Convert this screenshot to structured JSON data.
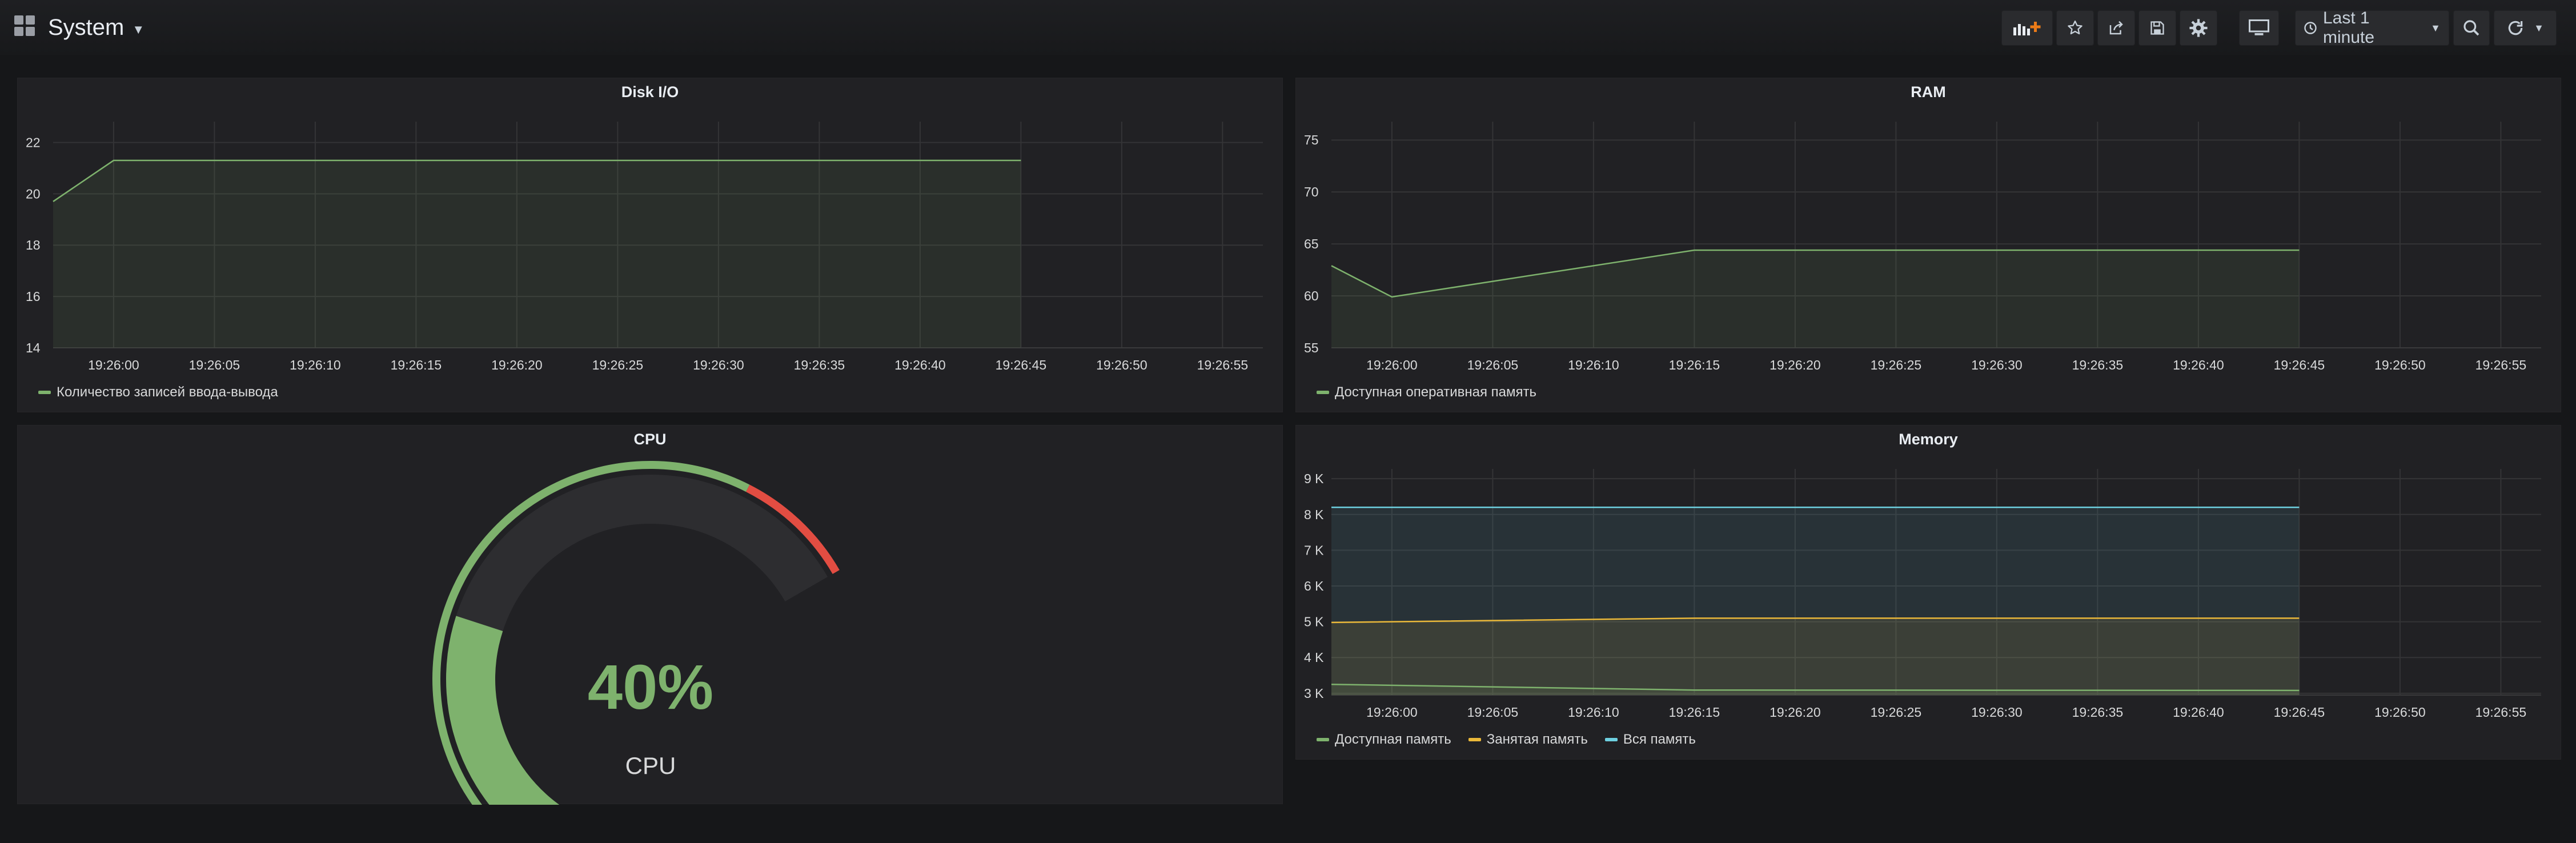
{
  "dashboard": {
    "title": "System",
    "time_range": "Last 1 minute"
  },
  "toolbar": {
    "add_panel_icon": "add-panel-icon",
    "star_icon": "star-icon",
    "share_icon": "share-icon",
    "save_icon": "save-icon",
    "settings_icon": "gear-icon",
    "tv_mode_icon": "monitor-icon",
    "clock_icon": "clock-icon",
    "zoom_icon": "zoom-out-icon",
    "refresh_icon": "refresh-icon",
    "refresh_caret_icon": "chevron-down-icon"
  },
  "colors": {
    "green": "#7eb26d",
    "yellow": "#eab839",
    "blue": "#6ed0e0",
    "red": "#e24d42"
  },
  "chart_data": [
    {
      "id": "disk",
      "type": "line",
      "title": "Disk I/O",
      "x": [
        "19:25:57",
        "19:26:00",
        "19:26:45"
      ],
      "x_ticks": [
        "19:26:00",
        "19:26:05",
        "19:26:10",
        "19:26:15",
        "19:26:20",
        "19:26:25",
        "19:26:30",
        "19:26:35",
        "19:26:40",
        "19:26:45",
        "19:26:50",
        "19:26:55"
      ],
      "y_ticks": [
        "14",
        "16",
        "18",
        "20",
        "22"
      ],
      "ylim": [
        14,
        22.5
      ],
      "series": [
        {
          "name": "Количество записей ввода-вывода",
          "color": "#7eb26d",
          "values": [
            19.7,
            21.3,
            21.3
          ]
        }
      ],
      "grid": true,
      "legend_position": "bottom-left"
    },
    {
      "id": "ram",
      "type": "line",
      "title": "RAM",
      "x": [
        "19:25:57",
        "19:26:00",
        "19:26:15",
        "19:26:45"
      ],
      "x_ticks": [
        "19:26:00",
        "19:26:05",
        "19:26:10",
        "19:26:15",
        "19:26:20",
        "19:26:25",
        "19:26:30",
        "19:26:35",
        "19:26:40",
        "19:26:45",
        "19:26:50",
        "19:26:55"
      ],
      "y_ticks": [
        "55",
        "60",
        "65",
        "70",
        "75"
      ],
      "ylim": [
        55,
        76
      ],
      "series": [
        {
          "name": "Доступная оперативная память",
          "color": "#7eb26d",
          "values": [
            62.9,
            59.9,
            64.4,
            64.4
          ]
        }
      ],
      "grid": true,
      "legend_position": "bottom-left"
    },
    {
      "id": "memory",
      "type": "area",
      "title": "Memory",
      "x": [
        "19:25:57",
        "19:26:15",
        "19:26:45"
      ],
      "x_ticks": [
        "19:26:00",
        "19:26:05",
        "19:26:10",
        "19:26:15",
        "19:26:20",
        "19:26:25",
        "19:26:30",
        "19:26:35",
        "19:26:40",
        "19:26:45",
        "19:26:50",
        "19:26:55"
      ],
      "y_ticks": [
        "3 K",
        "4 K",
        "5 K",
        "6 K",
        "7 K",
        "8 K",
        "9 K"
      ],
      "ylim": [
        2950,
        9050
      ],
      "series": [
        {
          "name": "Доступная память",
          "color": "#7eb26d",
          "values": [
            3250,
            3090,
            3080
          ]
        },
        {
          "name": "Занятая память",
          "color": "#eab839",
          "values": [
            4980,
            5100,
            5100
          ]
        },
        {
          "name": "Вся память",
          "color": "#6ed0e0",
          "values": [
            8200,
            8200,
            8200
          ]
        }
      ],
      "grid": true,
      "legend_position": "bottom-left"
    },
    {
      "id": "cpu",
      "type": "gauge",
      "title": "CPU",
      "value": 40,
      "value_label": "40%",
      "label": "CPU",
      "min": 0,
      "max": 100,
      "thresholds": [
        {
          "from": 0,
          "to": 85,
          "color": "#7eb26d"
        },
        {
          "from": 85,
          "to": 100,
          "color": "#e24d42"
        }
      ]
    }
  ]
}
